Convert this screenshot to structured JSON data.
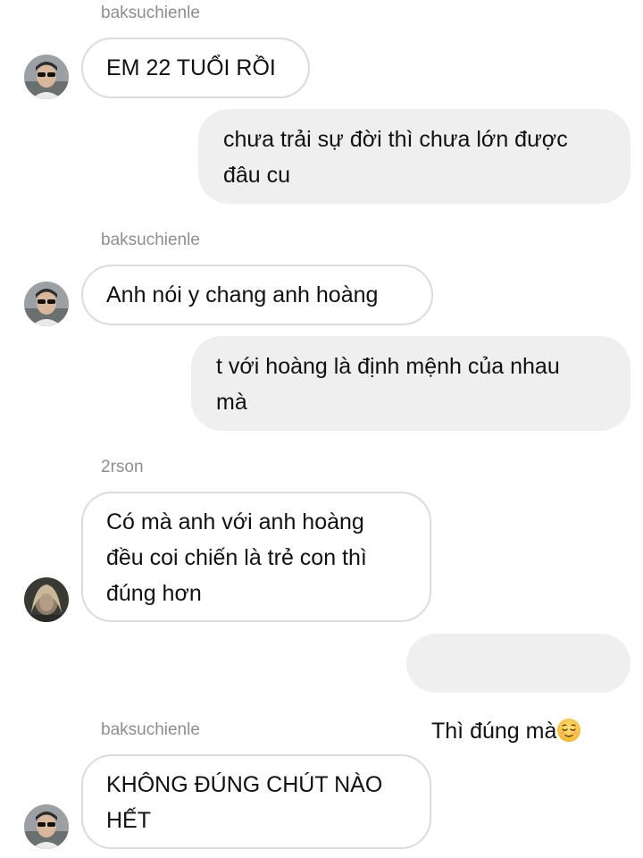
{
  "messages": [
    {
      "sender": "baksuchienle",
      "text": "EM 22 TUỔI RỒI",
      "avatar": "avatar-photo"
    },
    {
      "sender": "me",
      "text": "chưa trải sự đời thì chưa lớn được\nđâu cu"
    },
    {
      "sender": "baksuchienle",
      "text": "Anh nói y chang anh hoàng",
      "avatar": "avatar-photo"
    },
    {
      "sender": "me",
      "text": "t với hoàng là định mệnh của nhau\nmà"
    },
    {
      "sender": "2rson",
      "text": "Có mà anh với anh hoàng\nđều coi chiến là trẻ con thì\nđúng hơn",
      "avatar": "avatar-photo"
    },
    {
      "sender": "me",
      "text": "Thì đúng mà",
      "emoji": "relieved-face-emoji"
    },
    {
      "sender": "baksuchienle",
      "text": "KHÔNG ĐÚNG CHÚT NÀO\nHẾT",
      "avatar": "avatar-photo"
    }
  ],
  "colors": {
    "incoming_border": "#dbdbdb",
    "outgoing_bg": "#efefef",
    "username": "#8e8e8e",
    "text": "#111111"
  }
}
